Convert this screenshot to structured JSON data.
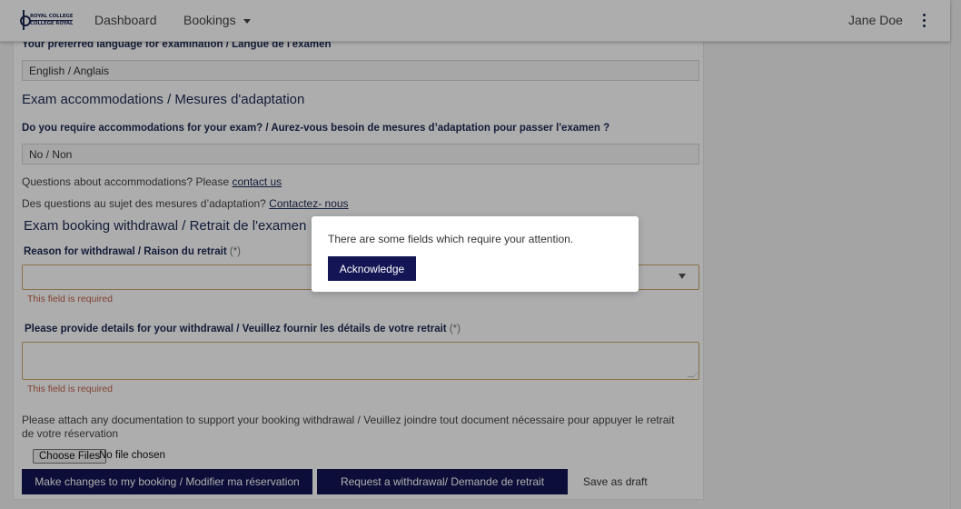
{
  "header": {
    "logo_line1": "ROYAL COLLEGE",
    "logo_line2": "COLLÈGE ROYAL",
    "nav": {
      "dashboard": "Dashboard",
      "bookings": "Bookings"
    },
    "user_name": "Jane Doe",
    "menu_icon": "kebab-menu-icon"
  },
  "form": {
    "language_label": "Your preferred language for examination / Langue de l'examen",
    "language_value": "English / Anglais",
    "accommodations_title": "Exam accommodations / Mesures d'adaptation",
    "accommodations_question": "Do you require accommodations for your exam? / Aurez-vous besoin de mesures d’adaptation pour passer l'examen ?",
    "accommodations_value": "No / Non",
    "help_en_text": "Questions about accommodations? Please ",
    "help_en_link": "contact us",
    "help_fr_text": "Des questions au sujet des mesures d’adaptation? ",
    "help_fr_link": "Contactez- nous",
    "withdrawal_title": "Exam booking withdrawal / Retrait de l'examen",
    "reason_label": "Reason for withdrawal / Raison du retrait",
    "required_marker": "(*)",
    "reason_error": "This field is required",
    "details_label": "Please provide details for your withdrawal / Veuillez fournir les détails de votre retrait",
    "details_error": "This field is required",
    "attach_text_line1": "Please attach any documentation to support your booking withdrawal   / Veuillez joindre tout document nécessaire pour appuyer le retrait",
    "attach_text_line2": "de votre réservation",
    "file_button": "Choose Files",
    "file_status": "No file chosen"
  },
  "actions": {
    "change_booking": "Make changes to my booking / Modifier ma réservation",
    "request_withdrawal": "Request a withdrawal/ Demande de retrait",
    "save_draft": "Save as draft"
  },
  "modal": {
    "message": "There are some fields which require your attention.",
    "button": "Acknowledge"
  },
  "colors": {
    "primary": "#131554",
    "heading": "#1d2951",
    "error": "#c0624a",
    "error_border": "#c8a86b"
  }
}
